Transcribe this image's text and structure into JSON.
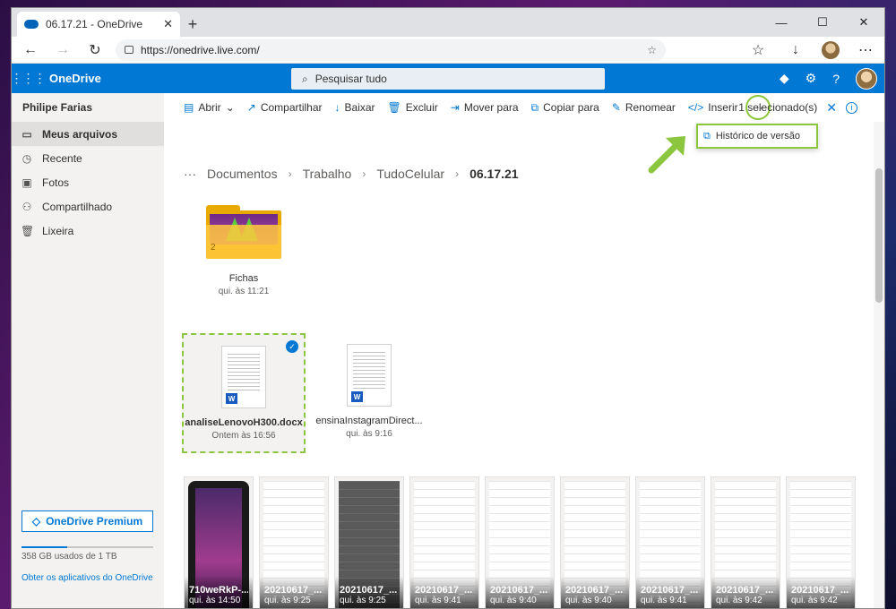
{
  "browser": {
    "tab_title": "06.17.21 - OneDrive",
    "tab_close": "✕",
    "new_tab": "+",
    "url": "https://onedrive.live.com/",
    "window_min": "—",
    "window_max": "☐",
    "window_close": "✕"
  },
  "header": {
    "brand": "OneDrive",
    "search_placeholder": "Pesquisar tudo"
  },
  "sidebar": {
    "user": "Philipe Farias",
    "items": [
      {
        "label": "Meus arquivos"
      },
      {
        "label": "Recente"
      },
      {
        "label": "Fotos"
      },
      {
        "label": "Compartilhado"
      },
      {
        "label": "Lixeira"
      }
    ],
    "premium": "OneDrive Premium",
    "storage": "358 GB usados de 1 TB",
    "storage_fraction": 0.35,
    "get_apps": "Obter os aplicativos do OneDrive"
  },
  "commands": {
    "open": "Abrir",
    "share": "Compartilhar",
    "download": "Baixar",
    "delete": "Excluir",
    "move": "Mover para",
    "copy": "Copiar para",
    "rename": "Renomear",
    "embed": "Inserir",
    "more": "···",
    "selected": "1 selecionado(s)",
    "version_history": "Histórico de versão"
  },
  "breadcrumb": {
    "more": "···",
    "items": [
      "Documentos",
      "Trabalho",
      "TudoCelular"
    ],
    "current": "06.17.21"
  },
  "folder": {
    "name": "Fichas",
    "date": "qui. às 11:21",
    "count": "2"
  },
  "docs": [
    {
      "name": "analiseLenovoH300.docx",
      "date": "Ontem às 16:56"
    },
    {
      "name": "ensinaInstagramDirect...",
      "date": "qui. às 9:16"
    }
  ],
  "thumbs": [
    {
      "name": "710weRkP-...",
      "date": "qui. às 14:50"
    },
    {
      "name": "20210617_...",
      "date": "qui. às 9:25"
    },
    {
      "name": "20210617_...",
      "date": "qui. às 9:25"
    },
    {
      "name": "20210617_...",
      "date": "qui. às 9:41"
    },
    {
      "name": "20210617_...",
      "date": "qui. às 9:40"
    },
    {
      "name": "20210617_...",
      "date": "qui. às 9:40"
    },
    {
      "name": "20210617_...",
      "date": "qui. às 9:41"
    },
    {
      "name": "20210617_...",
      "date": "qui. às 9:42"
    },
    {
      "name": "20210617_...",
      "date": "qui. às 9:42"
    }
  ],
  "colors": {
    "accent": "#0078d4",
    "highlight": "#8cc63f",
    "folder": "#ffc83d"
  }
}
